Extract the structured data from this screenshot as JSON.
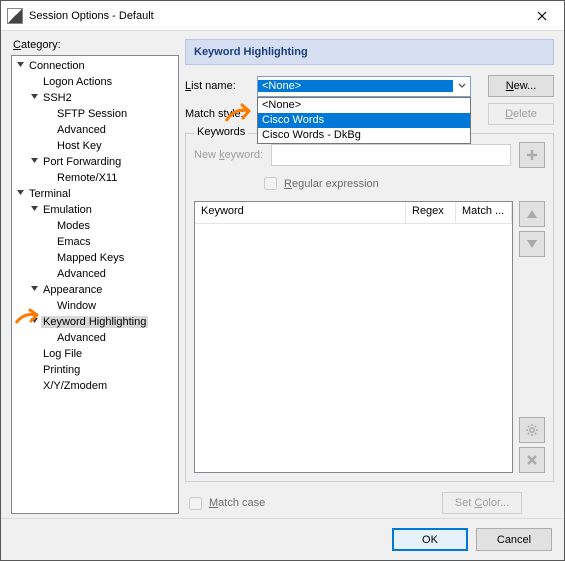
{
  "window": {
    "title": "Session Options - Default"
  },
  "category_label": "Category:",
  "tree": [
    {
      "label": "Connection",
      "ind": 0,
      "tw": "v"
    },
    {
      "label": "Logon Actions",
      "ind": 1,
      "tw": ""
    },
    {
      "label": "SSH2",
      "ind": 1,
      "tw": "v"
    },
    {
      "label": "SFTP Session",
      "ind": 2,
      "tw": ""
    },
    {
      "label": "Advanced",
      "ind": 2,
      "tw": ""
    },
    {
      "label": "Host Key",
      "ind": 2,
      "tw": ""
    },
    {
      "label": "Port Forwarding",
      "ind": 1,
      "tw": "v"
    },
    {
      "label": "Remote/X11",
      "ind": 2,
      "tw": ""
    },
    {
      "label": "Terminal",
      "ind": 0,
      "tw": "v"
    },
    {
      "label": "Emulation",
      "ind": 1,
      "tw": "v"
    },
    {
      "label": "Modes",
      "ind": 2,
      "tw": ""
    },
    {
      "label": "Emacs",
      "ind": 2,
      "tw": ""
    },
    {
      "label": "Mapped Keys",
      "ind": 2,
      "tw": ""
    },
    {
      "label": "Advanced",
      "ind": 2,
      "tw": ""
    },
    {
      "label": "Appearance",
      "ind": 1,
      "tw": "v"
    },
    {
      "label": "Window",
      "ind": 2,
      "tw": ""
    },
    {
      "label": "Keyword Highlighting",
      "ind": 1,
      "tw": "v",
      "sel": true
    },
    {
      "label": "Advanced",
      "ind": 2,
      "tw": ""
    },
    {
      "label": "Log File",
      "ind": 1,
      "tw": ""
    },
    {
      "label": "Printing",
      "ind": 1,
      "tw": ""
    },
    {
      "label": "X/Y/Zmodem",
      "ind": 1,
      "tw": ""
    }
  ],
  "panel": {
    "title": "Keyword Highlighting",
    "listname_label": "List name:",
    "listname_value": "<None>",
    "listname_options": [
      "<None>",
      "Cisco Words",
      "Cisco Words - DkBg"
    ],
    "matchstyle_label": "Match style:",
    "keywords_legend": "Keywords",
    "new_keyword_label": "New keyword:",
    "regex_label": "Regular expression",
    "table_headers": {
      "c1": "Keyword",
      "c2": "Regex",
      "c3": "Match ..."
    },
    "matchcase_label": "Match case",
    "new_btn": "New...",
    "delete_btn": "Delete",
    "setcolor_btn": "Set Color..."
  },
  "dialog": {
    "ok": "OK",
    "cancel": "Cancel"
  }
}
